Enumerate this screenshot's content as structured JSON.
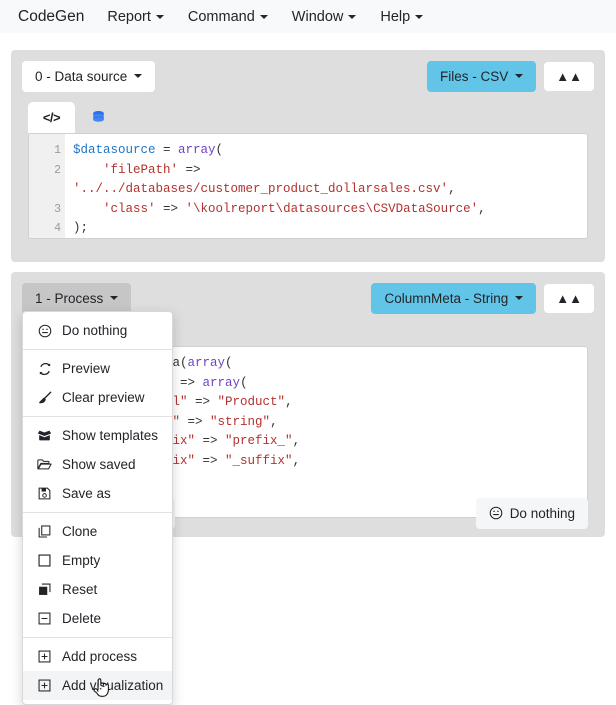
{
  "menubar": {
    "brand": "CodeGen",
    "items": [
      {
        "label": "Report"
      },
      {
        "label": "Command"
      },
      {
        "label": "Window"
      },
      {
        "label": "Help"
      }
    ]
  },
  "panels": [
    {
      "id": "datasource",
      "left_button": "0 - Data source",
      "type_button": "Files - CSV",
      "collapse_icon": "chevron-double-up-icon",
      "tabs": [
        {
          "name": "code-tab",
          "icon": "code-icon",
          "glyph": "</>",
          "selected": true
        },
        {
          "name": "database-tab",
          "icon": "database-icon",
          "glyph": "",
          "selected": false
        }
      ],
      "editor": {
        "lines": [
          "1",
          "2",
          "3",
          "4"
        ],
        "code_plain": "$datasource = array(\n    'filePath' => '../../databases/customer_product_dollarsales.csv',\n    'class' => '\\koolreport\\datasources\\CSVDataSource',\n);"
      }
    },
    {
      "id": "process",
      "left_button": "1 - Process",
      "type_button": "ColumnMeta - String",
      "collapse_icon": "chevron-double-up-icon",
      "editor": {
        "code_plain": "new ColumnMeta(array(\n    \"...Name\" => array(\n        \"label\" => \"Product\",\n        \"type\" => \"string\",\n        \"prefix\" => \"prefix_\",\n        \"suffix\" => \"_suffix\","
      },
      "actionbar": {
        "add_visualization": "Add visualization",
        "do_nothing": "Do nothing"
      }
    }
  ],
  "dropdown": {
    "groups": [
      [
        {
          "label": "Do nothing",
          "icon": "smiley-circle-icon",
          "hover": false
        }
      ],
      [
        {
          "label": "Preview",
          "icon": "refresh-icon",
          "hover": false
        },
        {
          "label": "Clear preview",
          "icon": "broom-icon",
          "hover": false
        }
      ],
      [
        {
          "label": "Show templates",
          "icon": "box-open-icon",
          "hover": false
        },
        {
          "label": "Show saved",
          "icon": "folder-open-icon",
          "hover": false
        },
        {
          "label": "Save as",
          "icon": "floppy-save-icon",
          "hover": false
        }
      ],
      [
        {
          "label": "Clone",
          "icon": "clone-icon",
          "hover": false
        },
        {
          "label": "Empty",
          "icon": "square-icon",
          "hover": false
        },
        {
          "label": "Reset",
          "icon": "layers-icon",
          "hover": false
        },
        {
          "label": "Delete",
          "icon": "minus-square-icon",
          "hover": false
        }
      ],
      [
        {
          "label": "Add process",
          "icon": "plus-square-icon",
          "hover": false
        },
        {
          "label": "Add visualization",
          "icon": "plus-square-icon",
          "hover": true
        }
      ]
    ]
  },
  "colors": {
    "accent_blue": "#62c5e8",
    "panel_gray": "#dedede",
    "menubar_bg": "#f7f9fa",
    "string_red": "#b4312e",
    "variable_blue": "#2176c7",
    "function_purple": "#6f42c1"
  },
  "cursor": {
    "icon": "pointing-hand-cursor"
  }
}
